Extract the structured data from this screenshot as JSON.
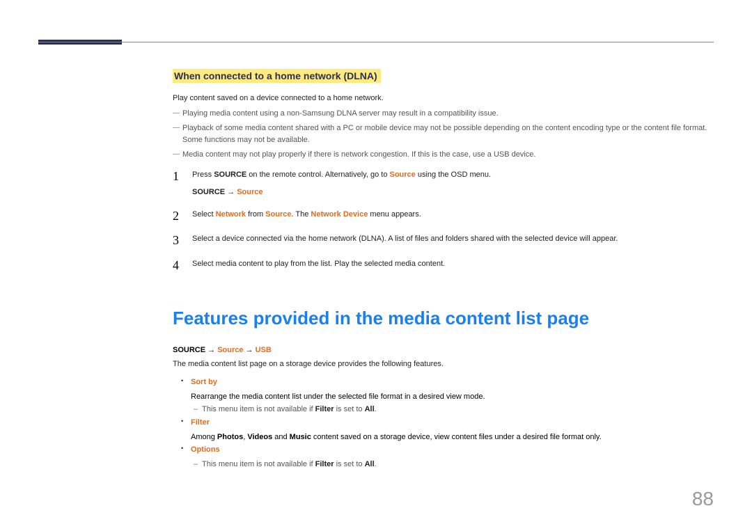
{
  "section_heading": "When connected to a home network (DLNA)",
  "intro_line": "Play content saved on a device connected to a home network.",
  "notes": [
    "Playing media content using a non-Samsung DLNA server may result in a compatibility issue.",
    "Playback of some media content shared with a PC or mobile device may not be possible depending on the content encoding type or the content file format. Some functions may not be available.",
    "Media content may not play properly if there is network congestion. If this is the case, use a USB device."
  ],
  "steps": {
    "s1": {
      "pre": "Press ",
      "bold1": "SOURCE",
      "mid": " on the remote control. Alternatively, go to ",
      "orange1": "Source",
      "post": " using the OSD menu.",
      "path_bold": "SOURCE",
      "path_arrow": " → ",
      "path_orange": "Source"
    },
    "s2": {
      "a": "Select ",
      "b": "Network",
      "c": " from ",
      "d": "Source",
      "e": ". The ",
      "f": "Network Device",
      "g": " menu appears."
    },
    "s3": "Select a device connected via the home network (DLNA). A list of files and folders shared with the selected device will appear.",
    "s4": "Select media content to play from the list. Play the selected media content."
  },
  "big_title": "Features provided in the media content list page",
  "path2": {
    "bold": "SOURCE",
    "arrow1": " → ",
    "orange1": "Source",
    "arrow2": " → ",
    "orange2": "USB"
  },
  "features_intro": "The media content list page on a storage device provides the following features.",
  "sortby": {
    "title": "Sort by",
    "desc": "Rearrange the media content list under the selected file format in a desired view mode.",
    "sub_a": "This menu item is not available if ",
    "sub_b": "Filter",
    "sub_c": " is set to ",
    "sub_d": "All",
    "sub_e": "."
  },
  "filter": {
    "title": "Filter",
    "a": "Among ",
    "b": "Photos",
    "c": ", ",
    "d": "Videos",
    "e": " and ",
    "f": "Music",
    "g": " content saved on a storage device, view content files under a desired file format only."
  },
  "options": {
    "title": "Options",
    "sub_a": "This menu item is not available if ",
    "sub_b": "Filter",
    "sub_c": " is set to ",
    "sub_d": "All",
    "sub_e": "."
  },
  "page_number": "88"
}
